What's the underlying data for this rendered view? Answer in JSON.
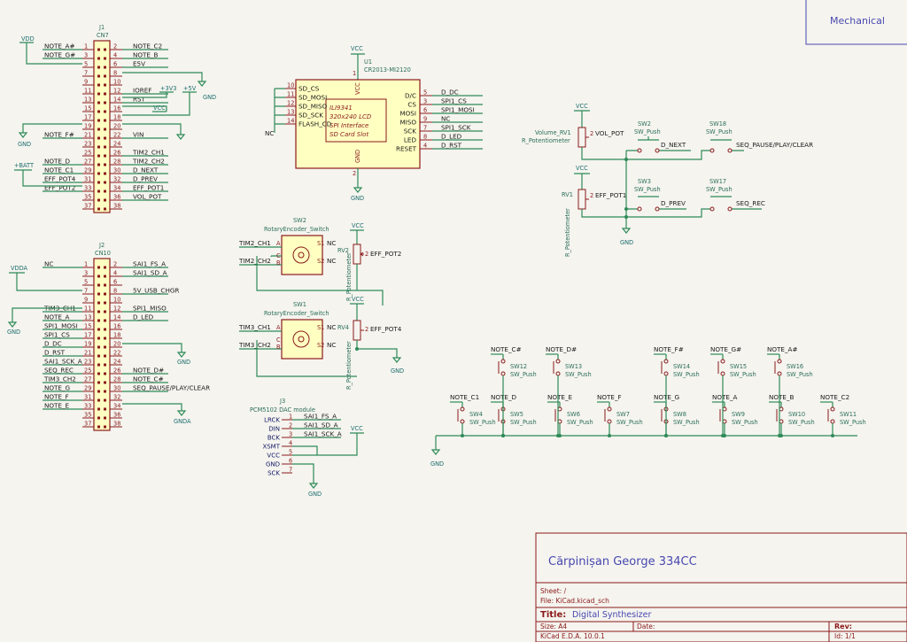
{
  "colors": {
    "background": "#f5f4ef",
    "wire": "#2e8b57",
    "component_outline": "#8b1a1a",
    "component_fill": "#ffffc2",
    "label_blue": "#4848b0",
    "text_dark": "#1b1b1b"
  },
  "mechanical": {
    "label": "Mechanical"
  },
  "j1": {
    "ref": "J1",
    "value": "CN7",
    "left_nets": [
      "NOTE_A#",
      "NOTE_G#",
      "",
      "",
      "",
      "",
      "",
      "",
      "",
      "",
      "NOTE_F#",
      "",
      "",
      "NOTE_D",
      "NOTE_C1",
      "EFF_POT4",
      "EFF_POT2"
    ],
    "right_nets": [
      "NOTE_C2",
      "NOTE_B",
      "E5V",
      "",
      "",
      "IOREF",
      "RST",
      "",
      "",
      "",
      "VIN",
      "",
      "TIM2_CH1",
      "TIM2_CH2",
      "D_NEXT",
      "D_PREV",
      "EFF_POT1",
      "VOL_POT"
    ],
    "left_pins": [
      "1",
      "3",
      "5",
      "7",
      "9",
      "11",
      "13",
      "15",
      "17",
      "19",
      "21",
      "23",
      "25",
      "27",
      "29",
      "31",
      "33",
      "35",
      "37"
    ],
    "right_pins": [
      "2",
      "4",
      "6",
      "8",
      "10",
      "12",
      "14",
      "16",
      "18",
      "20",
      "22",
      "24",
      "26",
      "28",
      "30",
      "32",
      "34",
      "36",
      "38"
    ],
    "power": {
      "vdd": "VDD",
      "p3v3": "+3V3",
      "p5v": "+5V",
      "vcc": "VCC",
      "gnd": "GND",
      "gnd2": "GND",
      "batt": "+BATT"
    }
  },
  "j2": {
    "ref": "J2",
    "value": "CN10",
    "left_nets": [
      "NC",
      "",
      "",
      "",
      "",
      "TIM3_CH1",
      "NOTE_A",
      "SPI1_MOSI",
      "SPI1_CS",
      "D_DC",
      "D_RST",
      "SAI1_SCK_A",
      "SEQ_REC",
      "TIM3_CH2",
      "NOTE_G",
      "NOTE_F",
      "NOTE_E"
    ],
    "right_nets": [
      "SAI1_FS_A",
      "SAI1_SD_A",
      "",
      "5V_USB_CHGR",
      "",
      "SPI1_MISO",
      "D_LED",
      "",
      "",
      "",
      "",
      "",
      "NOTE_D#",
      "NOTE_C#",
      "SEQ_PAUSE/PLAY/CLEAR",
      "",
      "",
      ""
    ],
    "left_pins": [
      "1",
      "3",
      "5",
      "7",
      "9",
      "11",
      "13",
      "15",
      "17",
      "19",
      "21",
      "23",
      "25",
      "27",
      "29",
      "31",
      "33",
      "35",
      "37"
    ],
    "right_pins": [
      "2",
      "4",
      "6",
      "8",
      "10",
      "12",
      "14",
      "16",
      "18",
      "20",
      "22",
      "24",
      "26",
      "28",
      "30",
      "32",
      "34",
      "36",
      "38"
    ],
    "power": {
      "vdda": "VDDA",
      "gnd": "GND",
      "gnd2": "GND",
      "gnda": "GNDA"
    }
  },
  "u1": {
    "ref": "U1",
    "value": "CR2013-MI2120",
    "left_pins": [
      {
        "num": "10",
        "name": "SD_CS"
      },
      {
        "num": "11",
        "name": "SD_MOSI"
      },
      {
        "num": "12",
        "name": "SD_MISO"
      },
      {
        "num": "13",
        "name": "SD_SCK"
      },
      {
        "num": "14",
        "name": "FLASH_CD"
      }
    ],
    "right_pins": [
      {
        "num": "5",
        "name": "D/C",
        "net": "D_DC"
      },
      {
        "num": "3",
        "name": "CS",
        "net": "SPI1_CS"
      },
      {
        "num": "6",
        "name": "MOSI",
        "net": "SPI1_MOSI"
      },
      {
        "num": "9",
        "name": "MISO",
        "net": "NC"
      },
      {
        "num": "7",
        "name": "SCK",
        "net": "SPI1_SCK"
      },
      {
        "num": "8",
        "name": "LED",
        "net": "D_LED"
      },
      {
        "num": "4",
        "name": "RESET",
        "net": "D_RST"
      }
    ],
    "inner": [
      "ILI9341",
      "320x240 LCD",
      "SPI Interface",
      "SD Card Slot"
    ],
    "vcc_pin": "1",
    "gnd_pin": "2",
    "vcc_name": "VCC",
    "gnd_name": "GND",
    "vcc": "VCC",
    "gnd": "GND",
    "nc": "NC"
  },
  "sw2": {
    "ref": "SW2",
    "value": "RotaryEncoder_Switch",
    "nets": [
      "TIM2_CH1",
      "TIM2_CH2"
    ],
    "pins": [
      "A",
      "C",
      "B",
      "S1",
      "S2"
    ],
    "nc": [
      "NC",
      "NC"
    ]
  },
  "sw1": {
    "ref": "SW1",
    "value": "RotaryEncoder_Switch",
    "nets": [
      "TIM3_CH1",
      "TIM3_CH2"
    ],
    "pins": [
      "A",
      "C",
      "B",
      "S1",
      "S2"
    ],
    "nc": [
      "NC",
      "NC"
    ]
  },
  "rv2": {
    "ref": "RV2",
    "value": "R_Potentiometer",
    "pin2": "2",
    "net": "EFF_POT2",
    "vcc": "VCC"
  },
  "rv4": {
    "ref": "RV4",
    "value": "R_Potentiometer",
    "pin2": "2",
    "net": "EFF_POT4",
    "vcc": "VCC",
    "gnd": "GND"
  },
  "rv1_volume": {
    "ref": "Volume_RV1",
    "value": "R_Potentiometer",
    "pin2": "2",
    "net": "VOL_POT",
    "vcc": "VCC"
  },
  "rv1": {
    "ref": "RV1",
    "value": "R_Potentiometer",
    "pin2": "2",
    "net": "EFF_POT1",
    "vcc": "VCC",
    "gnd": "GND"
  },
  "buttons_top": [
    {
      "ref": "SW2",
      "value": "SW_Push",
      "net": "D_NEXT"
    },
    {
      "ref": "SW18",
      "value": "SW_Push",
      "net": "SEQ_PAUSE/PLAY/CLEAR"
    },
    {
      "ref": "SW3",
      "value": "SW_Push",
      "net": "D_PREV"
    },
    {
      "ref": "SW17",
      "value": "SW_Push",
      "net": "SEQ_REC"
    }
  ],
  "j3": {
    "ref": "J3",
    "value": "PCM5102 DAC module",
    "pins": [
      {
        "name": "LRCK",
        "num": "1",
        "net": "SAI1_FS_A"
      },
      {
        "name": "DIN",
        "num": "2",
        "net": "SAI1_SD_A"
      },
      {
        "name": "BCK",
        "num": "3",
        "net": "SAI1_SCK_A"
      },
      {
        "name": "XSMT",
        "num": "4",
        "net": ""
      },
      {
        "name": "VCC",
        "num": "5",
        "net": ""
      },
      {
        "name": "GND",
        "num": "6",
        "net": ""
      },
      {
        "name": "SCK",
        "num": "7",
        "net": ""
      }
    ],
    "vcc": "VCC",
    "gnd": "GND"
  },
  "keys_upper": [
    {
      "net": "NOTE_C#",
      "ref": "SW12",
      "value": "SW_Push"
    },
    {
      "net": "NOTE_D#",
      "ref": "SW13",
      "value": "SW_Push"
    },
    {
      "net": "NOTE_F#",
      "ref": "SW14",
      "value": "SW_Push"
    },
    {
      "net": "NOTE_G#",
      "ref": "SW15",
      "value": "SW_Push"
    },
    {
      "net": "NOTE_A#",
      "ref": "SW16",
      "value": "SW_Push"
    }
  ],
  "keys_lower": [
    {
      "net": "NOTE_C1",
      "ref": "SW4",
      "value": "SW_Push"
    },
    {
      "net": "NOTE_D",
      "ref": "SW5",
      "value": "SW_Push"
    },
    {
      "net": "NOTE_E",
      "ref": "SW6",
      "value": "SW_Push"
    },
    {
      "net": "NOTE_F",
      "ref": "SW7",
      "value": "SW_Push"
    },
    {
      "net": "NOTE_G",
      "ref": "SW8",
      "value": "SW_Push"
    },
    {
      "net": "NOTE_A",
      "ref": "SW9",
      "value": "SW_Push"
    },
    {
      "net": "NOTE_B",
      "ref": "SW10",
      "value": "SW_Push"
    },
    {
      "net": "NOTE_C2",
      "ref": "SW11",
      "value": "SW_Push"
    }
  ],
  "keys_gnd": "GND",
  "title_block": {
    "author": "Cărpinișan George 334CC",
    "sheet": "Sheet: /",
    "file": "File: KiCad.kicad_sch",
    "title_label": "Title:",
    "title": "Digital Synthesizer",
    "size_label": "Size: A4",
    "date_label": "Date:",
    "rev_label": "Rev:",
    "tool": "KiCad E.D.A. 10.0.1",
    "id": "Id: 1/1"
  }
}
